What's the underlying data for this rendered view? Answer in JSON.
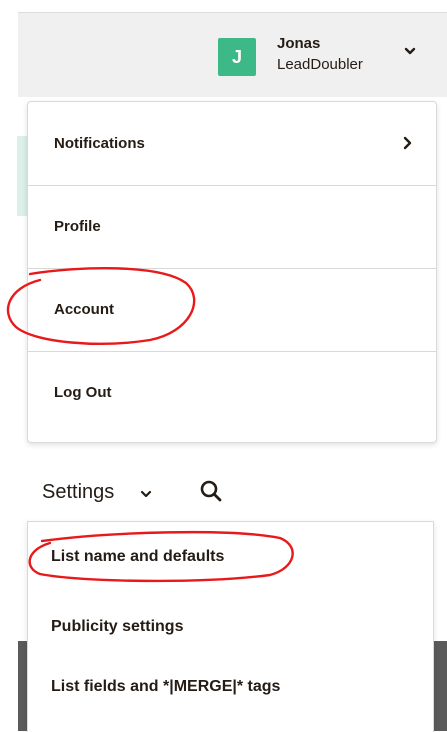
{
  "header": {
    "avatar_initial": "J",
    "user_name": "Jonas",
    "company": "LeadDoubler"
  },
  "account_menu": {
    "items": [
      {
        "label": "Notifications",
        "has_submenu": true
      },
      {
        "label": "Profile"
      },
      {
        "label": "Account",
        "annotated": true
      },
      {
        "label": "Log Out"
      }
    ]
  },
  "settings_toolbar": {
    "label": "Settings"
  },
  "settings_menu": {
    "items": [
      {
        "label": "List name and defaults",
        "annotated": true
      },
      {
        "label": "Publicity settings"
      },
      {
        "label": "List fields and *|MERGE|* tags"
      }
    ]
  },
  "colors": {
    "avatar": "#3db887",
    "annotation": "#e8191b",
    "text": "#241c15"
  }
}
